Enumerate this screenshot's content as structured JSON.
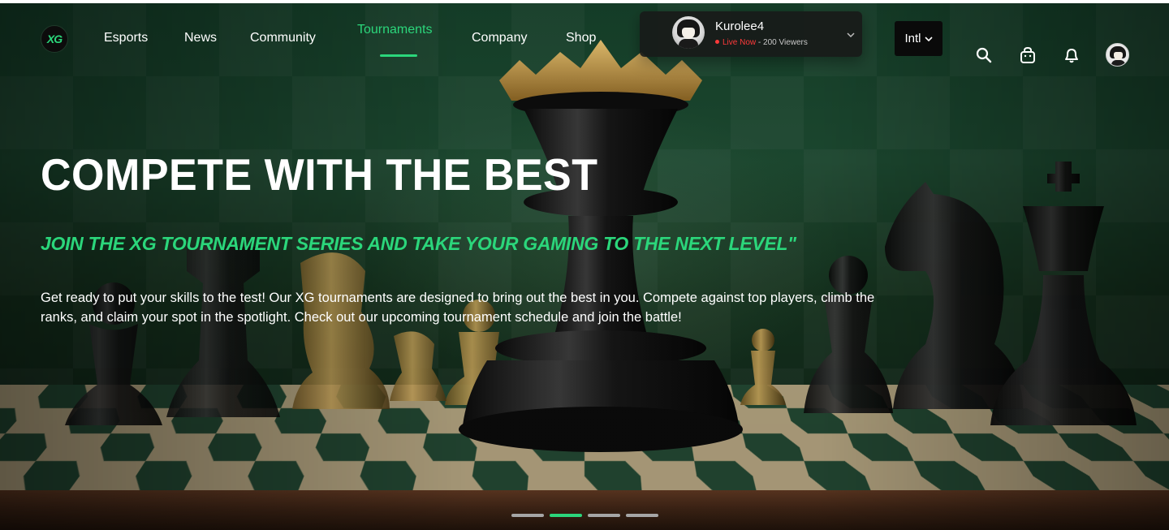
{
  "brand": {
    "logo_text": "XG"
  },
  "nav": {
    "items": [
      {
        "label": "Esports",
        "active": false
      },
      {
        "label": "News",
        "active": false
      },
      {
        "label": "Community",
        "active": false
      },
      {
        "label": "Tournaments",
        "active": true
      },
      {
        "label": "Company",
        "active": false
      },
      {
        "label": "Shop",
        "active": false
      }
    ]
  },
  "live": {
    "streamer": "Kurolee4",
    "status": "Live Now",
    "separator": " - ",
    "viewers": "200 Viewers"
  },
  "language": {
    "label": "Intl"
  },
  "header_icons": [
    "search-icon",
    "bag-icon",
    "bell-icon",
    "avatar"
  ],
  "hero": {
    "headline": "Compete With The Best",
    "subheadline": "Join The XG Tournament Series And Take Your Gaming To The Next Level\"",
    "body": "Get ready to put your skills to the test! Our XG tournaments are designed to bring out the best in you. Compete against top players, climb the ranks, and claim your spot in the spotlight. Check out our upcoming tournament schedule and join the battle!"
  },
  "carousel": {
    "slides": 4,
    "active_index": 1
  },
  "colors": {
    "accent": "#2bd67b",
    "live": "#ff3a3a",
    "card": "#181a19"
  }
}
